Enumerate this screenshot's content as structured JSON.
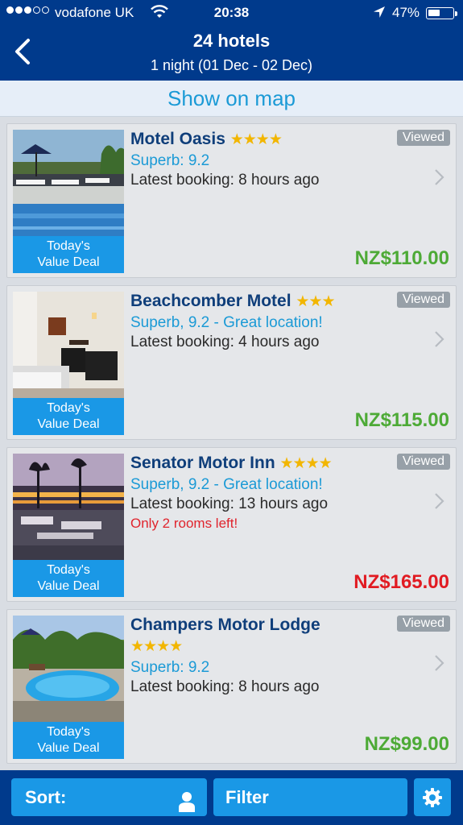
{
  "status_bar": {
    "carrier": "vodafone UK",
    "time": "20:38",
    "battery": "47%",
    "battery_level": 0.47
  },
  "header": {
    "title": "24 hotels",
    "subtitle": "1 night (01 Dec - 02 Dec)"
  },
  "map_link": "Show on map",
  "hotels": [
    {
      "name": "Motel Oasis",
      "stars": "★★★★",
      "score": "Superb: 9.2",
      "booking": "Latest booking: 8 hours ago",
      "alert": "",
      "price": "NZ$110.00",
      "price_color": "#4daa36",
      "viewed": "Viewed",
      "deal": "Today's\nValue Deal"
    },
    {
      "name": "Beachcomber Motel",
      "stars": "★★★",
      "score": "Superb, 9.2 - Great location!",
      "booking": "Latest booking: 4 hours ago",
      "alert": "",
      "price": "NZ$115.00",
      "price_color": "#4daa36",
      "viewed": "Viewed",
      "deal": "Today's\nValue Deal"
    },
    {
      "name": "Senator Motor Inn",
      "stars": "★★★★",
      "score": "Superb, 9.2 - Great location!",
      "booking": "Latest booking: 13 hours ago",
      "alert": "Only 2 rooms left!",
      "price": "NZ$165.00",
      "price_color": "#e11b22",
      "viewed": "Viewed",
      "deal": "Today's\nValue Deal"
    },
    {
      "name": "Champers Motor Lodge",
      "stars": "★★★★",
      "score": "Superb: 9.2",
      "booking": "Latest booking: 8 hours ago",
      "alert": "",
      "price": "NZ$99.00",
      "price_color": "#4daa36",
      "viewed": "Viewed",
      "deal": "Today's\nValue Deal"
    }
  ],
  "toolbar": {
    "sort_label": "Sort:",
    "filter_label": "Filter"
  },
  "colors": {
    "header_bg": "#003a8c",
    "accent": "#1a98e6",
    "link": "#1b9ad6",
    "star": "#f2b600"
  },
  "icons": [
    "back-chevron-icon",
    "wifi-icon",
    "location-arrow-icon",
    "battery-icon",
    "chevron-right-icon",
    "person-icon",
    "gear-icon"
  ]
}
